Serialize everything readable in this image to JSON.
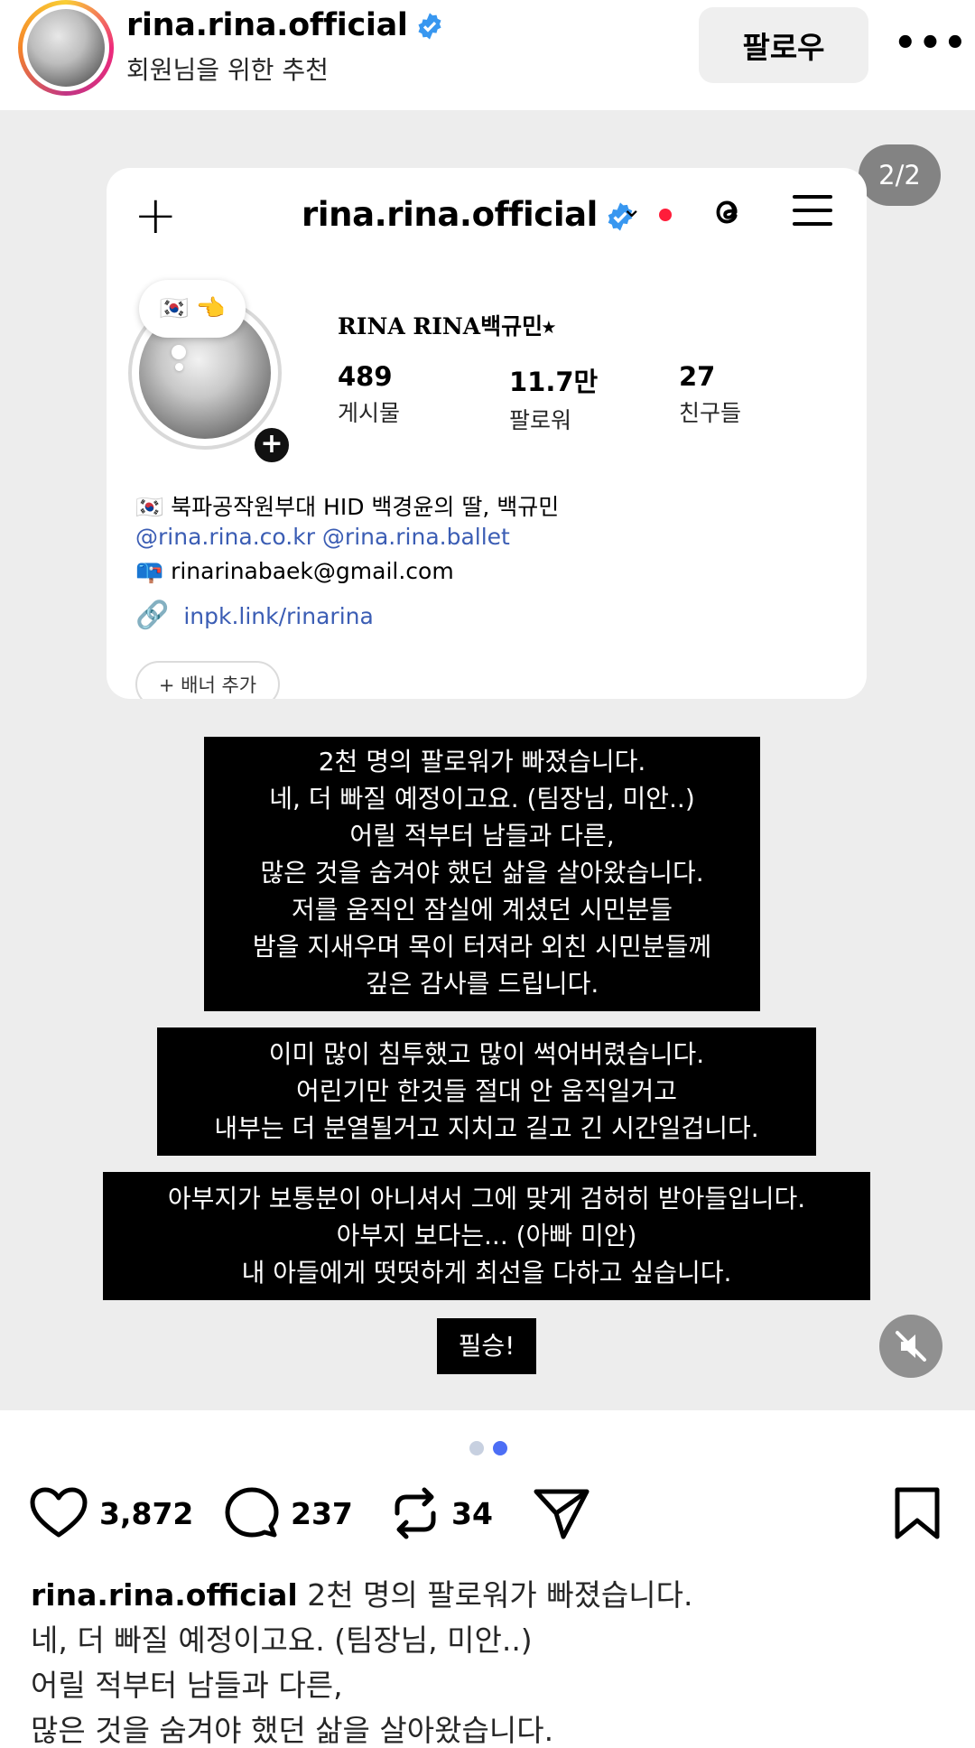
{
  "header": {
    "username": "rina.rina.official",
    "subtitle": "회원님을 위한 추천",
    "follow_label": "팔로우",
    "more_label": "•••"
  },
  "media": {
    "counter": "2/2",
    "profile": {
      "username": "rina.rina.official",
      "display_name": "RINA RINA백규민⭑",
      "note_emoji": "🇰🇷 👈",
      "stats": [
        {
          "value": "489",
          "label": "게시물"
        },
        {
          "value": "11.7만",
          "label": "팔로워"
        },
        {
          "value": "27",
          "label": "친구들"
        }
      ],
      "bio_line1": "🇰🇷 북파공작원부대 HID 백경윤의 딸, 백규민",
      "bio_mentions": "@rina.rina.co.kr @rina.rina.ballet",
      "bio_email": "📪 rinarinabaek@gmail.com",
      "bio_link": "inpk.link/rinarina",
      "banner_label": "+ 배너 추가"
    },
    "caption_boxes": [
      {
        "lines": [
          "2천 명의 팔로워가 빠졌습니다.",
          "네, 더 빠질 예정이고요. (팀장님, 미안..)",
          "어릴 적부터 남들과 다른,",
          "많은 것을 숨겨야 했던 삶을 살아왔습니다.",
          "저를 움직인 잠실에 계셨던 시민분들",
          "밤을 지새우며 목이 터져라 외친 시민분들께",
          "깊은 감사를 드립니다."
        ]
      },
      {
        "lines": [
          "이미 많이 침투했고 많이 썩어버렸습니다.",
          "어린기만 한것들 절대 안 움직일거고",
          "내부는 더 분열될거고 지치고 길고 긴 시간일겁니다."
        ]
      },
      {
        "lines": [
          "아부지가 보통분이 아니셔서 그에 맞게 검허히 받아들입니다.",
          "아부지 보다는... (아빠 미안)",
          "내 아들에게 떳떳하게 최선을 다하고 싶습니다."
        ]
      },
      {
        "lines": [
          "필승!"
        ]
      }
    ]
  },
  "carousel": {
    "total": 2,
    "active": 2
  },
  "actions": {
    "likes": "3,872",
    "comments": "237",
    "reposts": "34"
  },
  "caption": {
    "username": "rina.rina.official",
    "lines": [
      "2천 명의 팔로워가 빠졌습니다.",
      "네, 더 빠질 예정이고요. (팀장님, 미안..)",
      "어릴 적부터 남들과 다른,",
      "많은 것을 숨겨야 했던 삶을 살아왔습니다."
    ]
  },
  "colors": {
    "verified": "#3897f0",
    "link": "#3b5db4",
    "dot_active": "#4c6ef5",
    "dot_inactive": "#c7d0e0"
  }
}
